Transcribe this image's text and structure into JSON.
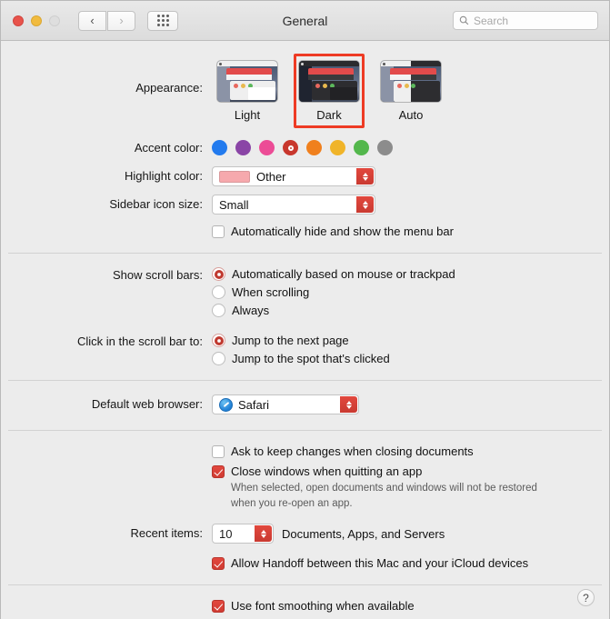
{
  "window": {
    "title": "General",
    "traffic_lights": [
      "close",
      "minimize",
      "zoom-disabled"
    ],
    "nav_back": "‹",
    "nav_forward": "›",
    "grid_button": "show-all-icon"
  },
  "search": {
    "placeholder": "Search",
    "icon": "search-icon"
  },
  "appearance": {
    "label": "Appearance:",
    "options": [
      {
        "name": "Light",
        "selected": false
      },
      {
        "name": "Dark",
        "selected": true
      },
      {
        "name": "Auto",
        "selected": false
      }
    ],
    "highlight_color": "#ee3b24"
  },
  "accent_color": {
    "label": "Accent color:",
    "selected_index": 3,
    "colors": [
      {
        "name": "blue",
        "hex": "#237bee"
      },
      {
        "name": "purple",
        "hex": "#8a45a6"
      },
      {
        "name": "pink",
        "hex": "#ec4c96"
      },
      {
        "name": "red",
        "hex": "#c8372d"
      },
      {
        "name": "orange",
        "hex": "#f0801d"
      },
      {
        "name": "yellow",
        "hex": "#f0b429"
      },
      {
        "name": "green",
        "hex": "#53b74c"
      },
      {
        "name": "graphite",
        "hex": "#8c8c8c"
      }
    ]
  },
  "highlight_color": {
    "label": "Highlight color:",
    "value": "Other",
    "swatch_hex": "#f6a9ad"
  },
  "sidebar_icon_size": {
    "label": "Sidebar icon size:",
    "value": "Small"
  },
  "menu_bar": {
    "checkbox_label": "Automatically hide and show the menu bar",
    "checked": false
  },
  "scroll_bars": {
    "label": "Show scroll bars:",
    "options": [
      {
        "label": "Automatically based on mouse or trackpad",
        "selected": true
      },
      {
        "label": "When scrolling",
        "selected": false
      },
      {
        "label": "Always",
        "selected": false
      }
    ]
  },
  "scroll_click": {
    "label": "Click in the scroll bar to:",
    "options": [
      {
        "label": "Jump to the next page",
        "selected": true
      },
      {
        "label": "Jump to the spot that's clicked",
        "selected": false
      }
    ]
  },
  "default_browser": {
    "label": "Default web browser:",
    "value": "Safari",
    "icon": "safari-icon"
  },
  "documents": {
    "ask_keep_changes": {
      "label": "Ask to keep changes when closing documents",
      "checked": false
    },
    "close_windows": {
      "label": "Close windows when quitting an app",
      "checked": true
    },
    "note_line1": "When selected, open documents and windows will not be restored",
    "note_line2": "when you re-open an app."
  },
  "recent_items": {
    "label": "Recent items:",
    "value": "10",
    "suffix": "Documents, Apps, and Servers"
  },
  "handoff": {
    "label": "Allow Handoff between this Mac and your iCloud devices",
    "checked": true
  },
  "font_smoothing": {
    "label": "Use font smoothing when available",
    "checked": true
  },
  "help_button": "?"
}
